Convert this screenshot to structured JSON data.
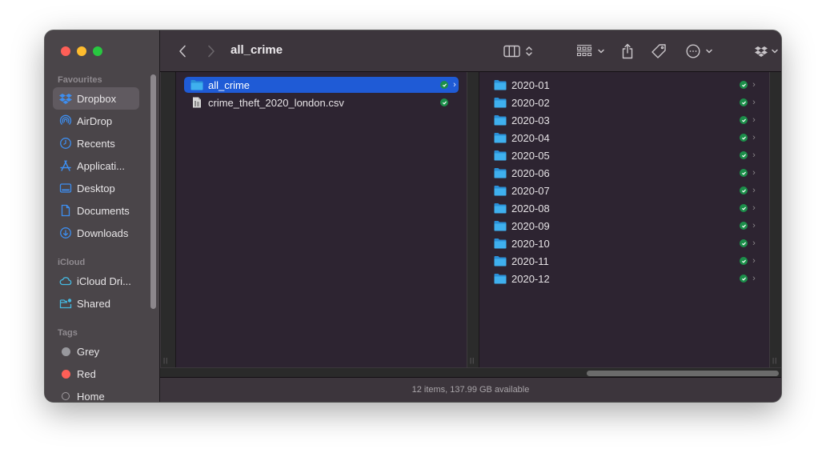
{
  "window": {
    "title": "all_crime",
    "traffic_lights": [
      "close",
      "minimize",
      "zoom"
    ]
  },
  "sidebar": {
    "sections": [
      {
        "label": "Favourites",
        "items": [
          {
            "label": "Dropbox",
            "icon": "dropbox-icon",
            "selected": true
          },
          {
            "label": "AirDrop",
            "icon": "airdrop-icon"
          },
          {
            "label": "Recents",
            "icon": "clock-icon"
          },
          {
            "label": "Applicati...",
            "icon": "applications-icon"
          },
          {
            "label": "Desktop",
            "icon": "desktop-icon"
          },
          {
            "label": "Documents",
            "icon": "document-icon"
          },
          {
            "label": "Downloads",
            "icon": "download-icon"
          }
        ]
      },
      {
        "label": "iCloud",
        "items": [
          {
            "label": "iCloud Dri...",
            "icon": "cloud-icon"
          },
          {
            "label": "Shared",
            "icon": "shared-folder-icon"
          }
        ]
      },
      {
        "label": "Tags",
        "items": [
          {
            "label": "Grey",
            "color": "#98989d"
          },
          {
            "label": "Red",
            "color": "#ff5f57"
          },
          {
            "label": "Home",
            "color": null
          }
        ]
      }
    ]
  },
  "toolbar": {
    "back": "chevron-left-icon",
    "forward": "chevron-right-icon",
    "view_mode": "columns-view-icon",
    "group": "grid-group-icon",
    "share": "share-icon",
    "tags": "tag-icon",
    "more": "ellipsis-circle-icon",
    "dropbox": "dropbox-icon",
    "search": "search-icon"
  },
  "columns": [
    {
      "items": [
        {
          "name": "all_crime",
          "type": "folder",
          "synced": true,
          "has_children": true,
          "selected": true
        },
        {
          "name": "crime_theft_2020_london.csv",
          "type": "file",
          "synced": true,
          "has_children": false
        }
      ]
    },
    {
      "items": [
        {
          "name": "2020-01",
          "type": "folder",
          "synced": true,
          "has_children": true
        },
        {
          "name": "2020-02",
          "type": "folder",
          "synced": true,
          "has_children": true
        },
        {
          "name": "2020-03",
          "type": "folder",
          "synced": true,
          "has_children": true
        },
        {
          "name": "2020-04",
          "type": "folder",
          "synced": true,
          "has_children": true
        },
        {
          "name": "2020-05",
          "type": "folder",
          "synced": true,
          "has_children": true
        },
        {
          "name": "2020-06",
          "type": "folder",
          "synced": true,
          "has_children": true
        },
        {
          "name": "2020-07",
          "type": "folder",
          "synced": true,
          "has_children": true
        },
        {
          "name": "2020-08",
          "type": "folder",
          "synced": true,
          "has_children": true
        },
        {
          "name": "2020-09",
          "type": "folder",
          "synced": true,
          "has_children": true
        },
        {
          "name": "2020-10",
          "type": "folder",
          "synced": true,
          "has_children": true
        },
        {
          "name": "2020-11",
          "type": "folder",
          "synced": true,
          "has_children": true
        },
        {
          "name": "2020-12",
          "type": "folder",
          "synced": true,
          "has_children": true
        }
      ]
    }
  ],
  "statusbar": {
    "text": "12 items, 137.99 GB available"
  },
  "colors": {
    "selection": "#1f5bd6",
    "sync_ok": "#1c8f4a",
    "folder": "#3aa9e8",
    "sidebar_icon": "#3d8ef0"
  }
}
